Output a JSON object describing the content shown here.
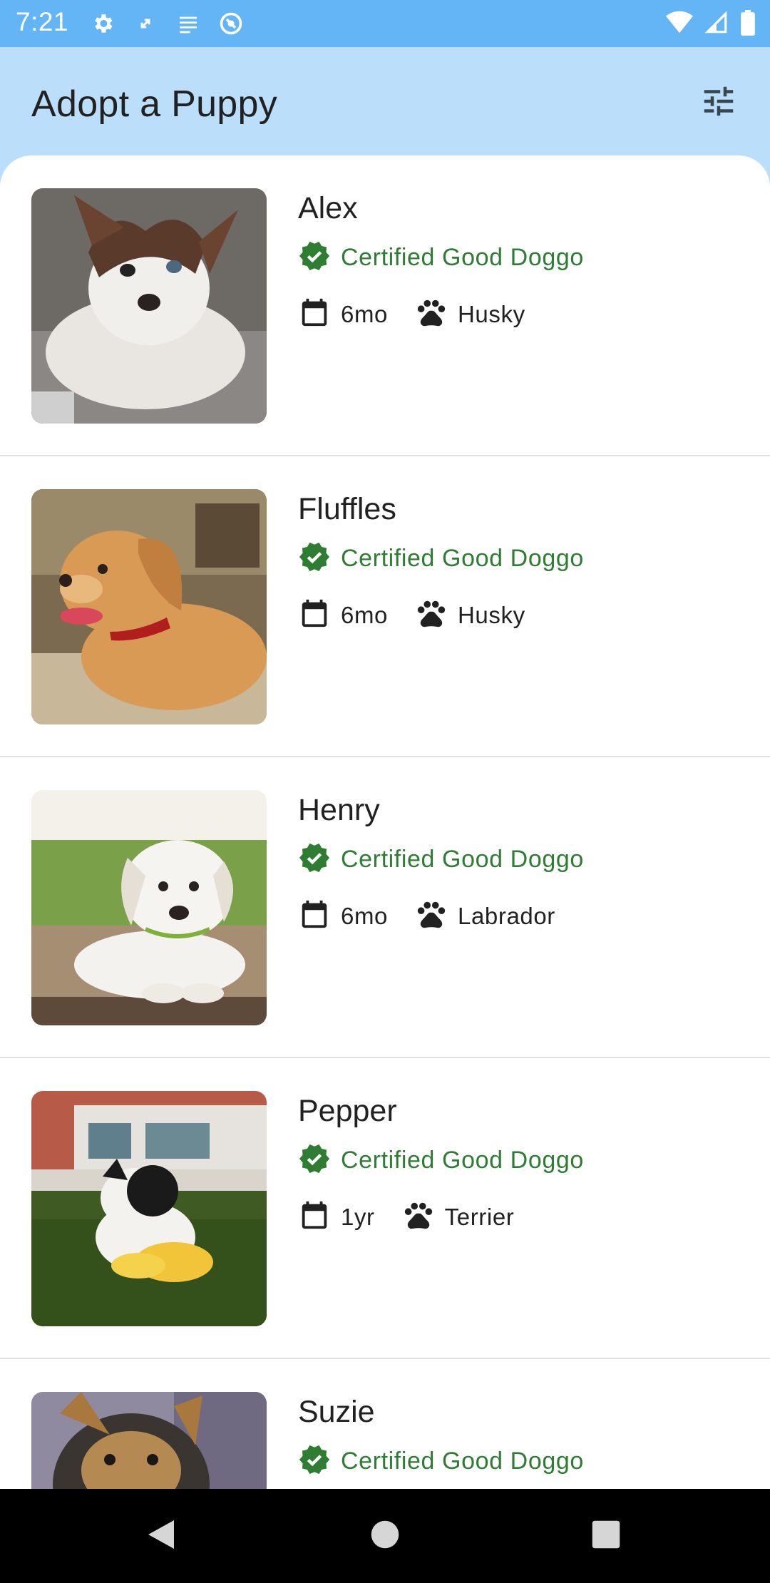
{
  "status_bar": {
    "time": "7:21",
    "left_icons": [
      "settings-icon",
      "screen-rotate-icon",
      "notes-icon",
      "vpn-icon"
    ],
    "right_icons": [
      "wifi-icon",
      "signal-icon",
      "battery-icon"
    ],
    "color": "#64b5f6"
  },
  "app_bar": {
    "title": "Adopt a Puppy",
    "action_icon": "tune-filter-icon",
    "background": "#bbdefb"
  },
  "accent_colors": {
    "certified_green": "#2e7d32"
  },
  "puppies": [
    {
      "name": "Alex",
      "badge": "Certified Good Doggo",
      "age": "6mo",
      "breed": "Husky",
      "photo": "husky puppy lying on floor"
    },
    {
      "name": "Fluffles",
      "badge": "Certified Good Doggo",
      "age": "6mo",
      "breed": "Husky",
      "photo": "golden puppy with red collar"
    },
    {
      "name": "Henry",
      "badge": "Certified Good Doggo",
      "age": "6mo",
      "breed": "Labrador",
      "photo": "white puppy on wooden deck"
    },
    {
      "name": "Pepper",
      "badge": "Certified Good Doggo",
      "age": "1yr",
      "breed": "Terrier",
      "photo": "black and white puppy with toy on grass"
    },
    {
      "name": "Suzie",
      "badge": "Certified Good Doggo",
      "age": "",
      "breed": "",
      "photo": "yorkie puppy"
    }
  ],
  "nav_bar": {
    "buttons": [
      "back-icon",
      "home-icon",
      "recents-icon"
    ]
  }
}
